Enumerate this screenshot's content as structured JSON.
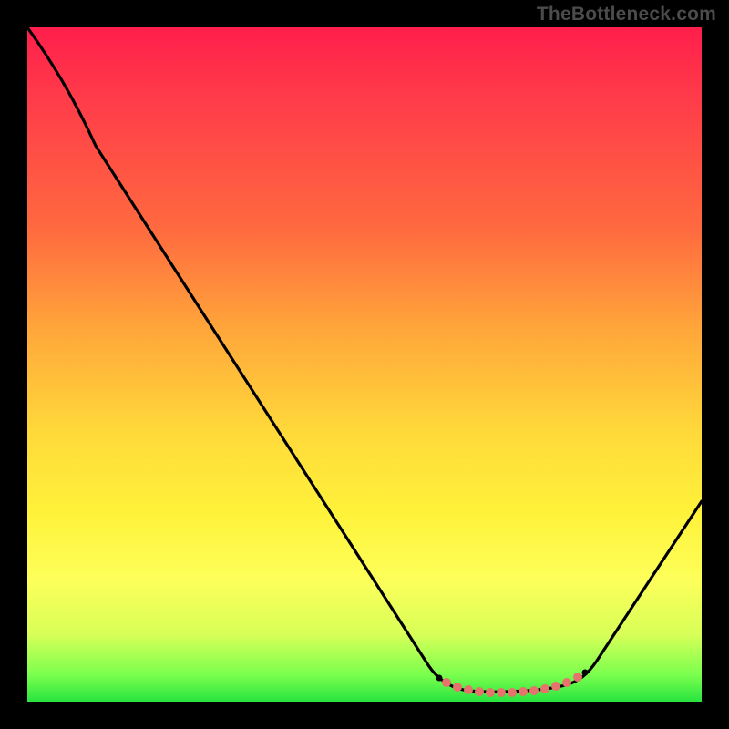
{
  "watermark": "TheBottleneck.com",
  "colors": {
    "frame": "#000000",
    "curve": "#000000",
    "dots": "#e6746d",
    "gradient_top": "#ff1e4b",
    "gradient_mid1": "#ffa73a",
    "gradient_mid2": "#fff23a",
    "gradient_bottom": "#28e43f"
  },
  "chart_data": {
    "type": "line",
    "title": "",
    "xlabel": "",
    "ylabel": "",
    "xlim": [
      0,
      100
    ],
    "ylim": [
      0,
      100
    ],
    "grid": false,
    "legend": false,
    "series": [
      {
        "name": "bottleneck-curve",
        "x": [
          0,
          5,
          10,
          15,
          20,
          25,
          30,
          35,
          40,
          45,
          50,
          55,
          60,
          63,
          66,
          69,
          72,
          75,
          78,
          81,
          84,
          88,
          92,
          96,
          100
        ],
        "y": [
          100,
          95,
          89,
          82,
          75,
          68,
          60,
          53,
          45,
          38,
          30,
          23,
          15,
          10,
          6,
          3,
          2,
          2,
          2,
          3,
          5,
          9,
          15,
          22,
          30
        ]
      }
    ],
    "highlight_range_x": [
      63,
      83
    ],
    "notes": "V-shaped curve with minimum (~2) near x≈74; coral dotted markers along trough x≈63–83; values estimated from pixels."
  }
}
